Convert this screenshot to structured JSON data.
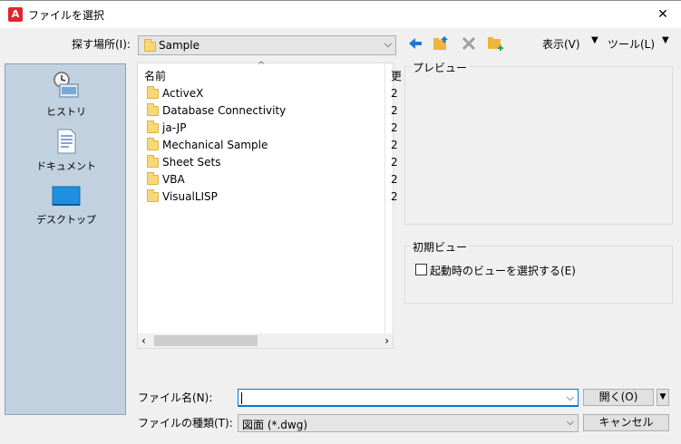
{
  "window": {
    "title": "ファイルを選択",
    "app_icon_letter": "A",
    "close": "✕"
  },
  "toolbar": {
    "look_in_label": "探す場所(I):",
    "look_in_value": "Sample",
    "view_menu": "表示(V)",
    "tools_menu": "ツール(L)",
    "icons": [
      "back-arrow-icon",
      "up-folder-icon",
      "delete-icon",
      "new-folder-icon"
    ]
  },
  "places": [
    {
      "label": "ヒストリ",
      "icon": "history-icon"
    },
    {
      "label": "ドキュメント",
      "icon": "documents-icon"
    },
    {
      "label": "デスクトップ",
      "icon": "desktop-icon"
    }
  ],
  "filelist": {
    "header_name": "名前",
    "header_second_col": "更",
    "rows": [
      {
        "name": "ActiveX",
        "date": "2"
      },
      {
        "name": "Database Connectivity",
        "date": "2"
      },
      {
        "name": "ja-JP",
        "date": "2"
      },
      {
        "name": "Mechanical Sample",
        "date": "2"
      },
      {
        "name": "Sheet Sets",
        "date": "2"
      },
      {
        "name": "VBA",
        "date": "2"
      },
      {
        "name": "VisualLISP",
        "date": "2"
      }
    ]
  },
  "preview": {
    "label": "プレビュー"
  },
  "initial_view": {
    "label": "初期ビュー",
    "checkbox_label": "起動時のビューを選択する(E)",
    "checked": false
  },
  "filename": {
    "label": "ファイル名(N):",
    "value": ""
  },
  "filetype": {
    "label": "ファイルの種類(T):",
    "value": "図面 (*.dwg)"
  },
  "buttons": {
    "open": "開く(O)",
    "cancel": "キャンセル"
  },
  "colors": {
    "places_bg": "#c2d1e0",
    "accent_blue": "#0078d7",
    "folder_yellow": "#f8d775",
    "app_red": "#e0262c"
  }
}
